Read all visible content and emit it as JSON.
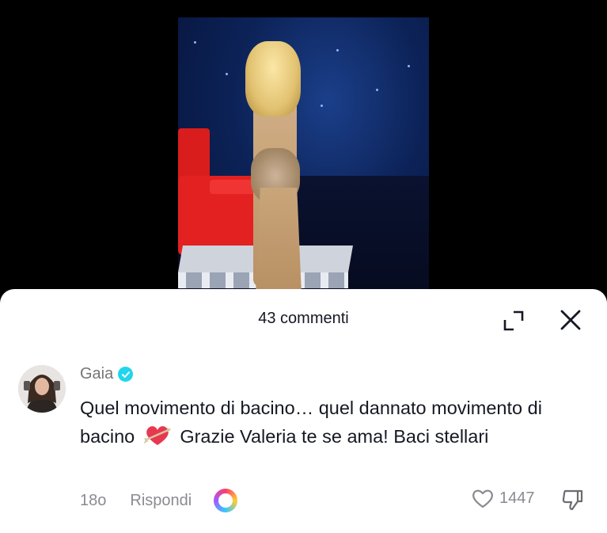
{
  "sheet": {
    "title": "43 commenti",
    "expand_icon": "expand-icon",
    "close_icon": "close-icon"
  },
  "comment": {
    "author": "Gaia",
    "verified": true,
    "text_part1": "Quel movimento di bacino… quel dannato movimento di bacino",
    "emoji": "heart-with-arrow",
    "text_part2": "Grazie Valeria te se ama! Baci stellari",
    "time": "18o",
    "reply_label": "Rispondi",
    "like_count": "1447"
  },
  "colors": {
    "text_primary": "#161823",
    "text_secondary": "#8a8b91",
    "verified": "#20d5ec",
    "emoji_heart": "#e8384f"
  }
}
